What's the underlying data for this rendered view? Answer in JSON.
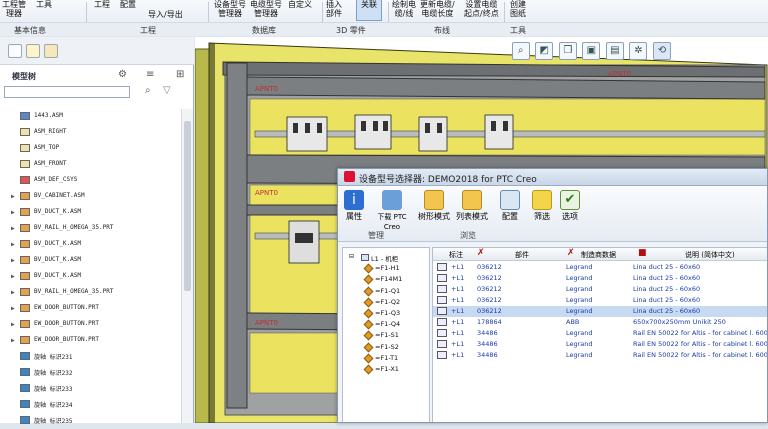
{
  "ribbon": {
    "buttons": [
      "工程管\n理器",
      "工具",
      "工程",
      "配置",
      "导入/导出",
      "设备型号\n管理器",
      "电缆型号\n管理器",
      "自定义",
      "插入\n部件",
      "关联",
      "绘制电\n缆/线",
      "更新电缆/\n电缆长度",
      "设置电缆\n起点/终点",
      "创建\n图纸"
    ],
    "groups": [
      "基本信息",
      "工程",
      "数据库",
      "3D 零件",
      "布线",
      "工具"
    ]
  },
  "left_panel": {
    "title": "模型树",
    "search_placeholder": "",
    "tree": [
      {
        "label": "1443.ASM",
        "icon": "assembly-icon",
        "toggle": ""
      },
      {
        "label": "ASM_RIGHT",
        "icon": "datum-plane-icon",
        "toggle": ""
      },
      {
        "label": "ASM_TOP",
        "icon": "datum-plane-icon",
        "toggle": ""
      },
      {
        "label": "ASM_FRONT",
        "icon": "datum-plane-icon",
        "toggle": ""
      },
      {
        "label": "ASM_DEF_CSYS",
        "icon": "csys-icon",
        "toggle": ""
      },
      {
        "label": "BV_CABINET.ASM",
        "icon": "part-icon",
        "toggle": "▶"
      },
      {
        "label": "BV_DUCT_K.ASM",
        "icon": "part-icon",
        "toggle": "▶"
      },
      {
        "label": "BV_RAIL_H_OMEGA_35.PRT",
        "icon": "part-icon",
        "toggle": "▶"
      },
      {
        "label": "BV_DUCT_K.ASM",
        "icon": "part-icon",
        "toggle": "▶"
      },
      {
        "label": "BV_DUCT_K.ASM",
        "icon": "part-icon",
        "toggle": "▶"
      },
      {
        "label": "BV_DUCT_K.ASM",
        "icon": "part-icon",
        "toggle": "▶"
      },
      {
        "label": "BV_RAIL_H_OMEGA_35.PRT",
        "icon": "part-icon",
        "toggle": "▶"
      },
      {
        "label": "EW_DOOR_BUTTON.PRT",
        "icon": "part-icon",
        "toggle": "▶"
      },
      {
        "label": "EW_DOOR_BUTTON.PRT",
        "icon": "part-icon",
        "toggle": "▶"
      },
      {
        "label": "EW_DOOR_BUTTON.PRT",
        "icon": "part-icon",
        "toggle": "▶"
      },
      {
        "label": "旋轴 标识231",
        "icon": "feature-icon",
        "toggle": ""
      },
      {
        "label": "旋轴 标识232",
        "icon": "feature-icon",
        "toggle": ""
      },
      {
        "label": "旋轴 标识233",
        "icon": "feature-icon",
        "toggle": ""
      },
      {
        "label": "旋轴 标识234",
        "icon": "feature-icon",
        "toggle": ""
      },
      {
        "label": "旋轴 标识235",
        "icon": "feature-icon",
        "toggle": ""
      }
    ]
  },
  "viewport": {
    "labels": [
      "APNT0",
      "APNT0",
      "APNT0",
      "APNT0"
    ],
    "tool_icons": [
      "zoom-icon",
      "shade-icon",
      "cube-icon",
      "view-icon",
      "save-view-icon",
      "datum-icon",
      "spin-icon"
    ]
  },
  "dialog": {
    "title": "设备型号选择器: DEMO2018 for PTC Creo",
    "buttons": [
      "属性",
      "下载 PTC\nCreo",
      "树形模式",
      "列表模式",
      "配置",
      "筛选",
      "选项"
    ],
    "groups": [
      "管理",
      "浏览"
    ],
    "tree": [
      "L1 - 机柜",
      "=F1-H1",
      "=F14M1",
      "=F1-Q1",
      "=F1-Q2",
      "=F1-Q3",
      "=F1-Q4",
      "=F1-S1",
      "=F1-S2",
      "=F1-T1",
      "=F1-X1"
    ],
    "columns": [
      "标注",
      "部件",
      "制造商数据",
      "说明 (简体中文)"
    ],
    "rows": [
      {
        "tag": "+L1",
        "part": "036212",
        "mfr": "Legrand",
        "desc": "Lina duct 25 - 60x60"
      },
      {
        "tag": "+L1",
        "part": "036212",
        "mfr": "Legrand",
        "desc": "Lina duct 25 - 60x60"
      },
      {
        "tag": "+L1",
        "part": "036212",
        "mfr": "Legrand",
        "desc": "Lina duct 25 - 60x60"
      },
      {
        "tag": "+L1",
        "part": "036212",
        "mfr": "Legrand",
        "desc": "Lina duct 25 - 60x60"
      },
      {
        "tag": "+L1",
        "part": "036212",
        "mfr": "Legrand",
        "desc": "Lina duct 25 - 60x60"
      },
      {
        "tag": "+L1",
        "part": "178864",
        "mfr": "ABB",
        "desc": "650x700x250mm Unikit 250"
      },
      {
        "tag": "+L1",
        "part": "34486",
        "mfr": "Legrand",
        "desc": "Rail EN 50022 for Altis - for cabinet l. 600"
      },
      {
        "tag": "+L1",
        "part": "34486",
        "mfr": "Legrand",
        "desc": "Rail EN 50022 for Altis - for cabinet l. 600"
      },
      {
        "tag": "+L1",
        "part": "34486",
        "mfr": "Legrand",
        "desc": "Rail EN 50022 for Altis - for cabinet l. 600"
      }
    ]
  }
}
